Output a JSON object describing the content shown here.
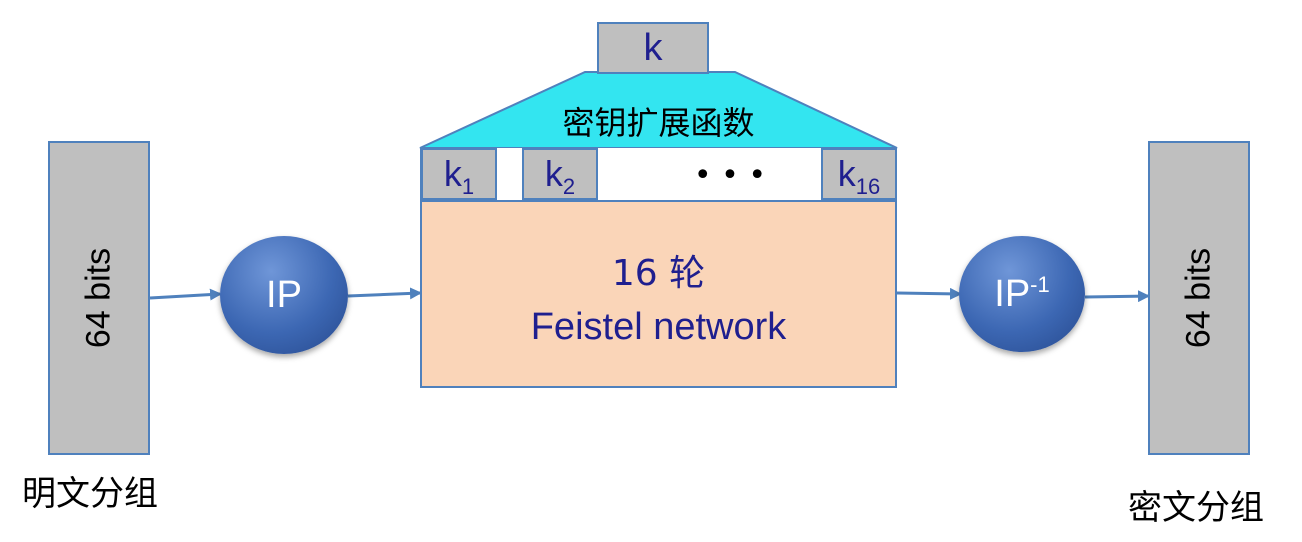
{
  "key": {
    "label": "k"
  },
  "key_schedule": {
    "label": "密钥扩展函数"
  },
  "subkeys": [
    {
      "base": "k",
      "sub": "1"
    },
    {
      "base": "k",
      "sub": "2"
    },
    {
      "base": "k",
      "sub": "16"
    }
  ],
  "ellipsis": "• • •",
  "rounds": {
    "line1": "16 轮",
    "line2": "Feistel network"
  },
  "input_block": {
    "bits": "64  bits",
    "caption": "明文分组"
  },
  "output_block": {
    "bits": "64  bits",
    "caption": "密文分组"
  },
  "ip": {
    "label": "IP"
  },
  "ip_inv": {
    "label": "IP",
    "sup": "-1"
  },
  "colors": {
    "block_fill": "#bfbfbf",
    "border": "#4f81bd",
    "trapezoid": "#33e5f0",
    "rounds_fill": "#fad5b8",
    "text_blue": "#1f1f8f",
    "arrow": "#4f81bd"
  }
}
